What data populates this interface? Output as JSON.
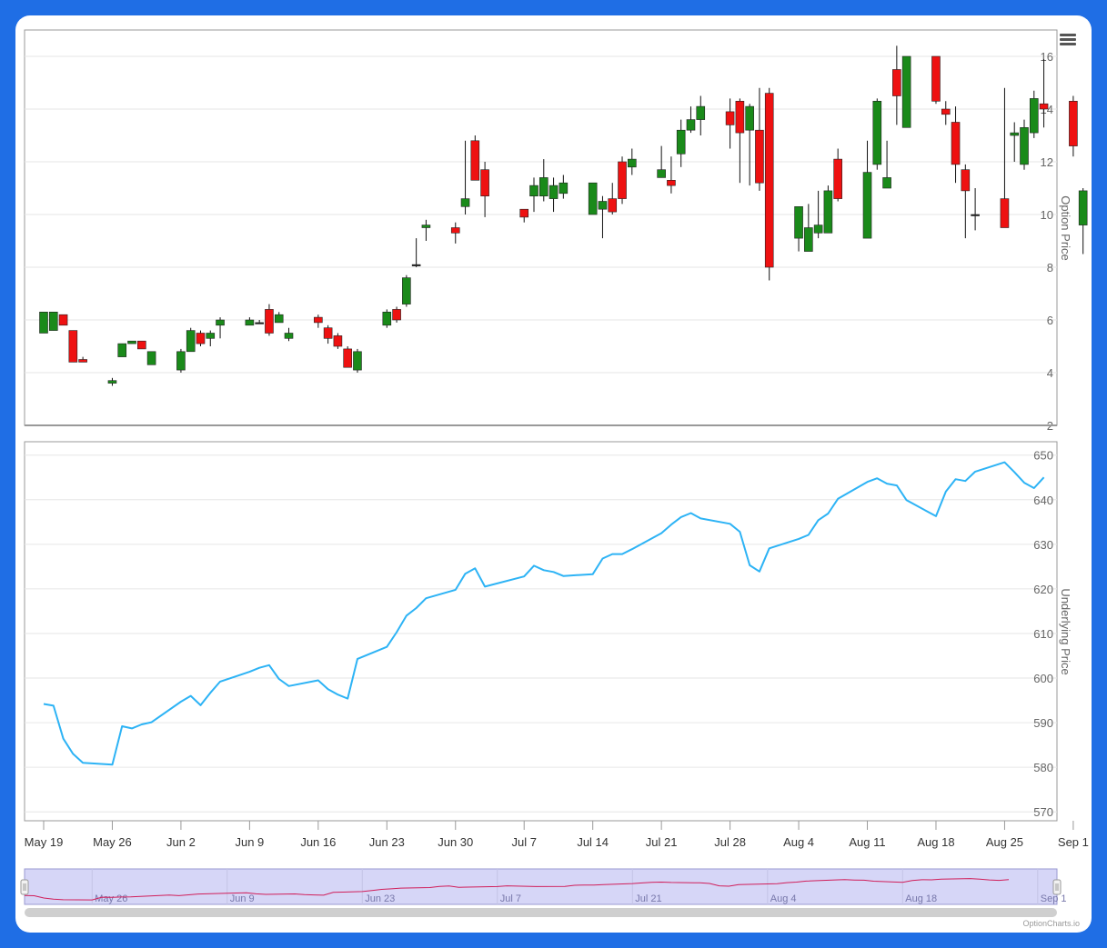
{
  "credit": "OptionCharts.io",
  "menu_icon": "hamburger-menu-icon",
  "colors": {
    "up": "#1a8a1a",
    "down": "#ee1111",
    "line": "#2db3f5",
    "navigator_fill": "#d6d6f7",
    "navigator_line": "#d01e5a"
  },
  "chart_data": [
    {
      "type": "candlestick",
      "ylabel": "Option Price",
      "ylim": [
        2,
        17
      ],
      "yticks": [
        2,
        4,
        6,
        8,
        10,
        12,
        14,
        16
      ],
      "x": [
        "2025-05-19",
        "2025-05-20",
        "2025-05-21",
        "2025-05-22",
        "2025-05-23",
        "2025-05-26",
        "2025-05-27",
        "2025-05-28",
        "2025-05-29",
        "2025-05-30",
        "2025-06-02",
        "2025-06-03",
        "2025-06-04",
        "2025-06-05",
        "2025-06-06",
        "2025-06-09",
        "2025-06-10",
        "2025-06-11",
        "2025-06-12",
        "2025-06-13",
        "2025-06-16",
        "2025-06-17",
        "2025-06-18",
        "2025-06-19",
        "2025-06-20",
        "2025-06-23",
        "2025-06-24",
        "2025-06-25",
        "2025-06-26",
        "2025-06-27",
        "2025-06-30",
        "2025-07-01",
        "2025-07-02",
        "2025-07-03",
        "2025-07-07",
        "2025-07-08",
        "2025-07-09",
        "2025-07-10",
        "2025-07-11",
        "2025-07-14",
        "2025-07-15",
        "2025-07-16",
        "2025-07-17",
        "2025-07-18",
        "2025-07-21",
        "2025-07-22",
        "2025-07-23",
        "2025-07-24",
        "2025-07-25",
        "2025-07-28",
        "2025-07-29",
        "2025-07-30",
        "2025-07-31",
        "2025-08-01",
        "2025-08-04",
        "2025-08-05",
        "2025-08-06",
        "2025-08-07",
        "2025-08-08",
        "2025-08-11",
        "2025-08-12",
        "2025-08-13",
        "2025-08-14",
        "2025-08-15",
        "2025-08-18",
        "2025-08-19",
        "2025-08-20",
        "2025-08-21",
        "2025-08-22",
        "2025-08-25",
        "2025-08-26",
        "2025-08-27",
        "2025-08-28",
        "2025-08-29",
        "2025-09-01",
        "2025-09-02"
      ],
      "open": [
        5.5,
        5.6,
        6.2,
        5.6,
        4.5,
        3.6,
        4.6,
        5.1,
        5.2,
        4.3,
        4.1,
        4.8,
        5.5,
        5.3,
        5.8,
        5.8,
        5.9,
        6.4,
        5.9,
        5.3,
        6.1,
        5.7,
        5.4,
        4.9,
        4.1,
        5.8,
        6.4,
        6.6,
        8.1,
        9.5,
        9.5,
        10.3,
        12.8,
        11.7,
        10.2,
        10.7,
        10.7,
        10.6,
        10.8,
        10.0,
        10.2,
        10.6,
        12.0,
        11.8,
        11.4,
        11.3,
        12.3,
        13.2,
        13.6,
        13.9,
        14.3,
        13.2,
        13.2,
        14.6,
        9.1,
        8.6,
        9.3,
        9.3,
        12.1,
        9.1,
        11.9,
        11.0,
        15.5,
        13.3,
        16.0,
        14.0,
        13.5,
        11.7,
        10.0,
        10.6,
        13.0,
        11.9,
        13.1,
        14.2,
        14.3,
        9.6,
        11.6
      ],
      "close": [
        6.3,
        6.3,
        5.8,
        4.4,
        4.4,
        3.7,
        5.1,
        5.2,
        4.9,
        4.8,
        4.8,
        5.6,
        5.1,
        5.5,
        6.0,
        6.0,
        5.9,
        5.5,
        6.2,
        5.5,
        5.9,
        5.3,
        5.0,
        4.2,
        4.8,
        6.3,
        6.0,
        7.6,
        8.1,
        9.6,
        9.3,
        10.6,
        11.3,
        10.7,
        9.9,
        11.1,
        11.4,
        11.1,
        11.2,
        11.2,
        10.5,
        10.1,
        10.6,
        12.1,
        11.7,
        11.1,
        13.2,
        13.6,
        14.1,
        13.4,
        13.1,
        14.1,
        11.2,
        8.0,
        10.3,
        9.5,
        9.6,
        10.9,
        10.6,
        11.6,
        14.3,
        11.4,
        14.5,
        16.0,
        14.3,
        13.8,
        11.9,
        10.9,
        10.0,
        9.5,
        13.1,
        13.3,
        14.4,
        14.0,
        12.6,
        10.9,
        11.9
      ],
      "high": [
        6.3,
        6.3,
        6.2,
        5.6,
        4.6,
        3.8,
        5.1,
        5.2,
        5.2,
        4.8,
        4.9,
        5.7,
        5.6,
        5.6,
        6.1,
        6.1,
        6.0,
        6.6,
        6.3,
        5.7,
        6.2,
        5.8,
        5.5,
        5.0,
        4.9,
        6.4,
        6.5,
        7.7,
        9.1,
        9.8,
        9.7,
        12.8,
        13.0,
        12.0,
        10.2,
        11.4,
        12.1,
        11.4,
        11.5,
        11.2,
        10.7,
        11.2,
        12.2,
        12.5,
        12.6,
        12.2,
        13.6,
        14.1,
        14.5,
        14.4,
        14.4,
        14.2,
        14.8,
        14.8,
        9.2,
        10.4,
        10.9,
        11.1,
        12.5,
        12.8,
        14.4,
        12.8,
        16.4,
        16.0,
        16.0,
        14.3,
        14.1,
        11.9,
        11.0,
        14.8,
        13.5,
        13.6,
        14.7,
        15.9,
        14.5,
        11.0,
        12.0
      ],
      "low": [
        5.5,
        5.6,
        5.8,
        4.4,
        4.4,
        3.5,
        4.6,
        5.1,
        4.9,
        4.3,
        4.0,
        4.8,
        5.0,
        5.0,
        5.3,
        5.8,
        5.9,
        5.4,
        5.9,
        5.2,
        5.7,
        5.1,
        4.9,
        4.2,
        4.0,
        5.7,
        5.9,
        6.5,
        8.0,
        9.0,
        8.9,
        10.0,
        11.3,
        9.9,
        9.7,
        10.1,
        10.5,
        10.1,
        10.6,
        10.0,
        9.1,
        10.0,
        10.4,
        11.5,
        11.4,
        10.8,
        11.8,
        13.1,
        13.0,
        12.5,
        11.2,
        11.1,
        10.9,
        7.5,
        8.6,
        9.2,
        9.1,
        9.4,
        10.5,
        10.9,
        11.7,
        11.3,
        13.4,
        13.3,
        14.2,
        13.4,
        11.2,
        9.1,
        9.4,
        9.5,
        12.0,
        11.7,
        12.9,
        13.3,
        12.2,
        8.5,
        11.5
      ]
    },
    {
      "type": "line",
      "ylabel": "Underlying Price",
      "ylim": [
        568,
        653
      ],
      "yticks": [
        570,
        580,
        590,
        600,
        610,
        620,
        630,
        640,
        650
      ],
      "xticks": [
        "May 19",
        "May 26",
        "Jun 2",
        "Jun 9",
        "Jun 16",
        "Jun 23",
        "Jun 30",
        "Jul 7",
        "Jul 14",
        "Jul 21",
        "Jul 28",
        "Aug 4",
        "Aug 11",
        "Aug 18",
        "Aug 25",
        "Sep 1"
      ],
      "x": [
        "2025-05-19",
        "2025-05-20",
        "2025-05-21",
        "2025-05-22",
        "2025-05-23",
        "2025-05-26",
        "2025-05-27",
        "2025-05-28",
        "2025-05-29",
        "2025-05-30",
        "2025-06-02",
        "2025-06-03",
        "2025-06-04",
        "2025-06-05",
        "2025-06-06",
        "2025-06-09",
        "2025-06-10",
        "2025-06-11",
        "2025-06-12",
        "2025-06-13",
        "2025-06-16",
        "2025-06-17",
        "2025-06-18",
        "2025-06-19",
        "2025-06-20",
        "2025-06-23",
        "2025-06-24",
        "2025-06-25",
        "2025-06-26",
        "2025-06-27",
        "2025-06-30",
        "2025-07-01",
        "2025-07-02",
        "2025-07-03",
        "2025-07-07",
        "2025-07-08",
        "2025-07-09",
        "2025-07-10",
        "2025-07-11",
        "2025-07-14",
        "2025-07-15",
        "2025-07-16",
        "2025-07-17",
        "2025-07-18",
        "2025-07-21",
        "2025-07-22",
        "2025-07-23",
        "2025-07-24",
        "2025-07-25",
        "2025-07-28",
        "2025-07-29",
        "2025-07-30",
        "2025-07-31",
        "2025-08-01",
        "2025-08-04",
        "2025-08-05",
        "2025-08-06",
        "2025-08-07",
        "2025-08-08",
        "2025-08-11",
        "2025-08-12",
        "2025-08-13",
        "2025-08-14",
        "2025-08-15",
        "2025-08-18",
        "2025-08-19",
        "2025-08-20",
        "2025-08-21",
        "2025-08-22",
        "2025-08-25",
        "2025-08-26",
        "2025-08-27",
        "2025-08-28",
        "2025-08-29",
        "2025-09-01",
        "2025-09-02"
      ],
      "y": [
        594.2,
        593.8,
        586.4,
        583.0,
        581.0,
        580.6,
        589.2,
        588.7,
        589.6,
        590.1,
        594.7,
        596.0,
        593.9,
        596.7,
        599.2,
        601.4,
        602.3,
        602.9,
        599.8,
        598.2,
        599.5,
        597.5,
        596.3,
        595.4,
        604.3,
        607.0,
        610.3,
        614.0,
        615.7,
        617.9,
        619.8,
        623.4,
        624.6,
        620.5,
        622.8,
        625.2,
        624.2,
        623.8,
        622.9,
        623.3,
        626.8,
        627.8,
        627.8,
        628.9,
        632.5,
        634.4,
        636.1,
        637.0,
        635.8,
        634.6,
        632.8,
        625.3,
        623.9,
        629.1,
        631.2,
        632.1,
        635.4,
        636.9,
        640.2,
        644.0,
        644.8,
        643.6,
        643.2,
        639.9,
        636.3,
        641.8,
        644.6,
        644.2,
        646.3,
        648.4,
        646.2,
        643.8,
        642.6,
        645.0
      ]
    }
  ],
  "navigator": {
    "labels": [
      "May 26",
      "Jun 9",
      "Jun 23",
      "Jul 7",
      "Jul 21",
      "Aug 4",
      "Aug 18",
      "Sep 1"
    ]
  }
}
